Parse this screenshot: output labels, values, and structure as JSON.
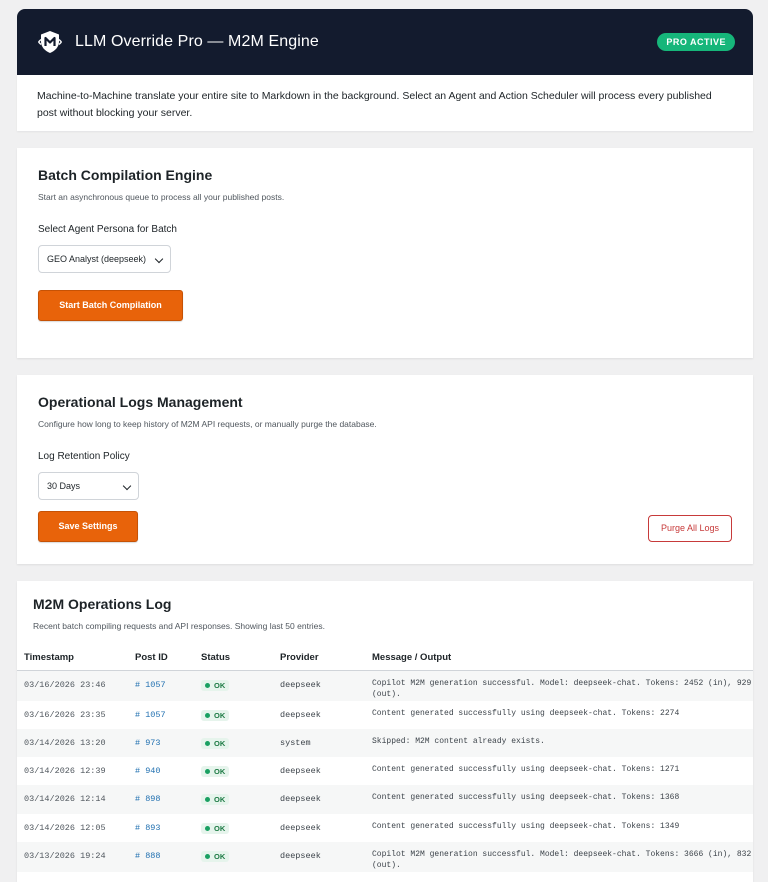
{
  "header": {
    "title": "LLM Override Pro — M2M Engine",
    "badge": "PRO ACTIVE",
    "intro": "Machine-to-Machine translate your entire site to Markdown in the background. Select an Agent and Action Scheduler will process every published post without blocking your server."
  },
  "batch": {
    "title": "Batch Compilation Engine",
    "description": "Start an asynchronous queue to process all your published posts.",
    "select_label": "Select Agent Persona for Batch",
    "select_value": "GEO Analyst (deepseek)",
    "start_button": "Start Batch Compilation"
  },
  "logs_mgmt": {
    "title": "Operational Logs Management",
    "description": "Configure how long to keep history of M2M API requests, or manually purge the database.",
    "retention_label": "Log Retention Policy",
    "retention_value": "30 Days",
    "save_button": "Save Settings",
    "purge_button": "Purge All Logs"
  },
  "ops_log": {
    "title": "M2M Operations Log",
    "description": "Recent batch compiling requests and API responses. Showing last 50 entries.",
    "columns": [
      "Timestamp",
      "Post ID",
      "Status",
      "Provider",
      "Message / Output"
    ],
    "rows": [
      {
        "ts": "03/16/2026 23:46",
        "post": "# 1057",
        "status": "OK",
        "provider": "deepseek",
        "msg": "Copilot M2M generation successful. Model: deepseek-chat. Tokens: 2452 (in), 929 (out)."
      },
      {
        "ts": "03/16/2026 23:35",
        "post": "# 1057",
        "status": "OK",
        "provider": "deepseek",
        "msg": "Content generated successfully using deepseek-chat. Tokens: 2274"
      },
      {
        "ts": "03/14/2026 13:20",
        "post": "# 973",
        "status": "OK",
        "provider": "system",
        "msg": "Skipped: M2M content already exists."
      },
      {
        "ts": "03/14/2026 12:39",
        "post": "# 940",
        "status": "OK",
        "provider": "deepseek",
        "msg": "Content generated successfully using deepseek-chat. Tokens: 1271"
      },
      {
        "ts": "03/14/2026 12:14",
        "post": "# 898",
        "status": "OK",
        "provider": "deepseek",
        "msg": "Content generated successfully using deepseek-chat. Tokens: 1368"
      },
      {
        "ts": "03/14/2026 12:05",
        "post": "# 893",
        "status": "OK",
        "provider": "deepseek",
        "msg": "Content generated successfully using deepseek-chat. Tokens: 1349"
      },
      {
        "ts": "03/13/2026 19:24",
        "post": "# 888",
        "status": "OK",
        "provider": "deepseek",
        "msg": "Copilot M2M generation successful. Model: deepseek-chat. Tokens: 3666 (in), 832 (out)."
      }
    ]
  },
  "colors": {
    "header_bg": "#131b2e",
    "accent": "#e8630a",
    "badge": "#16b67a",
    "danger": "#c73a3a",
    "ok": "#1aa062"
  },
  "icons": {
    "logo": "shield-m-logo-icon",
    "select": "chevron-down-icon",
    "status": "status-dot-icon"
  }
}
